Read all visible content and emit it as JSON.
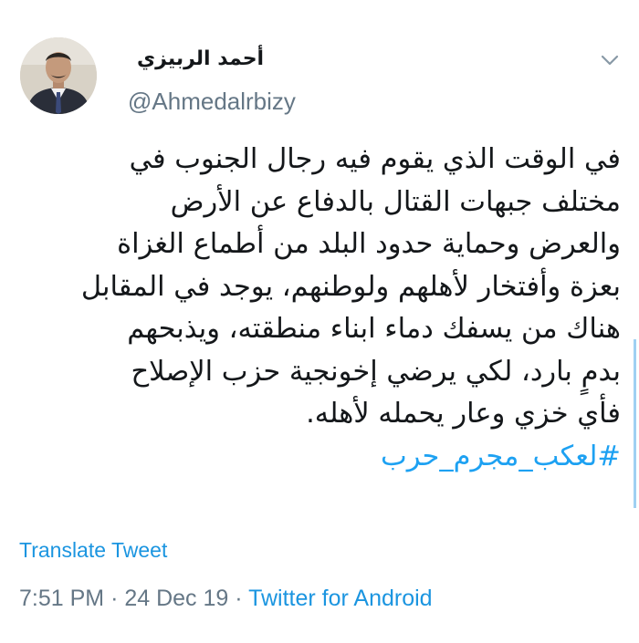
{
  "user": {
    "display_name": "أحمد الربيزي",
    "handle": "@Ahmedalrbizy",
    "avatar_icon": "profile-photo"
  },
  "tweet": {
    "lines": [
      "في الوقت الذي يقوم فيه رجال الجنوب في",
      "مختلف جبهات القتال بالدفاع عن الأرض",
      "والعرض وحماية حدود البلد من أطماع الغزاة",
      "بعزة وأفتخار لأهلهم ولوطنهم، يوجد في المقابل",
      "هناك من يسفك دماء ابناء منطقته، ويذبحهم",
      "بدمٍ بارد، لكي يرضي إخونجية حزب الإصلاح",
      "فأي خزي وعار يحمله لأهله."
    ],
    "hashtag": "#لعكب_مجرم_حرب"
  },
  "translate_label": "Translate Tweet",
  "meta": {
    "time": "7:51 PM",
    "separator": "·",
    "date": "24 Dec 19",
    "source": "Twitter for Android"
  },
  "colors": {
    "link": "#1b95e0",
    "secondary": "#657786",
    "text": "#14171a"
  },
  "icons": {
    "menu": "chevron-down-icon"
  }
}
